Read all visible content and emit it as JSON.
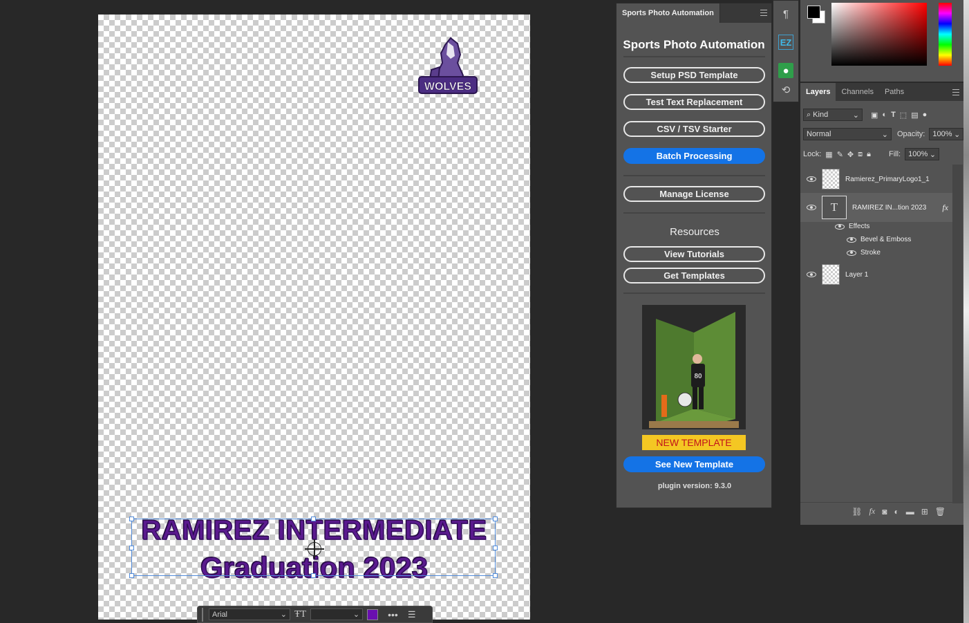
{
  "canvas": {
    "logo_text": "WOLVES",
    "text_line1": "RAMIREZ INTERMEDIATE",
    "text_line2": "Graduation 2023"
  },
  "taskbar": {
    "font": "Arial",
    "font_size": "",
    "color": "#6a0fb0"
  },
  "plugin": {
    "tab": "Sports Photo Automation",
    "title": "Sports Photo Automation",
    "buttons": {
      "setup": "Setup PSD Template",
      "test": "Test Text Replacement",
      "csv": "CSV / TSV Starter",
      "batch": "Batch Processing",
      "license": "Manage License",
      "tutorials": "View Tutorials",
      "templates": "Get Templates",
      "see_new": "See New Template"
    },
    "resources_heading": "Resources",
    "promo_label": "NEW TEMPLATE",
    "version": "plugin version: 9.3.0"
  },
  "toolstrip": {
    "ez_label": "EZ"
  },
  "layers": {
    "tabs": [
      "Layers",
      "Channels",
      "Paths"
    ],
    "filter": "Kind",
    "blend_mode": "Normal",
    "opacity_label": "Opacity:",
    "opacity": "100%",
    "lock_label": "Lock:",
    "fill_label": "Fill:",
    "fill": "100%",
    "items": [
      {
        "name": "Ramierez_PrimaryLogo1_1"
      },
      {
        "name": "RAMIREZ IN...tion 2023",
        "fx": "fx"
      },
      {
        "name": "Layer 1"
      }
    ],
    "effects_label": "Effects",
    "effect1": "Bevel & Emboss",
    "effect2": "Stroke"
  },
  "colors": {
    "accent": "#1473e6",
    "text_fill": "#5a1a8e"
  }
}
